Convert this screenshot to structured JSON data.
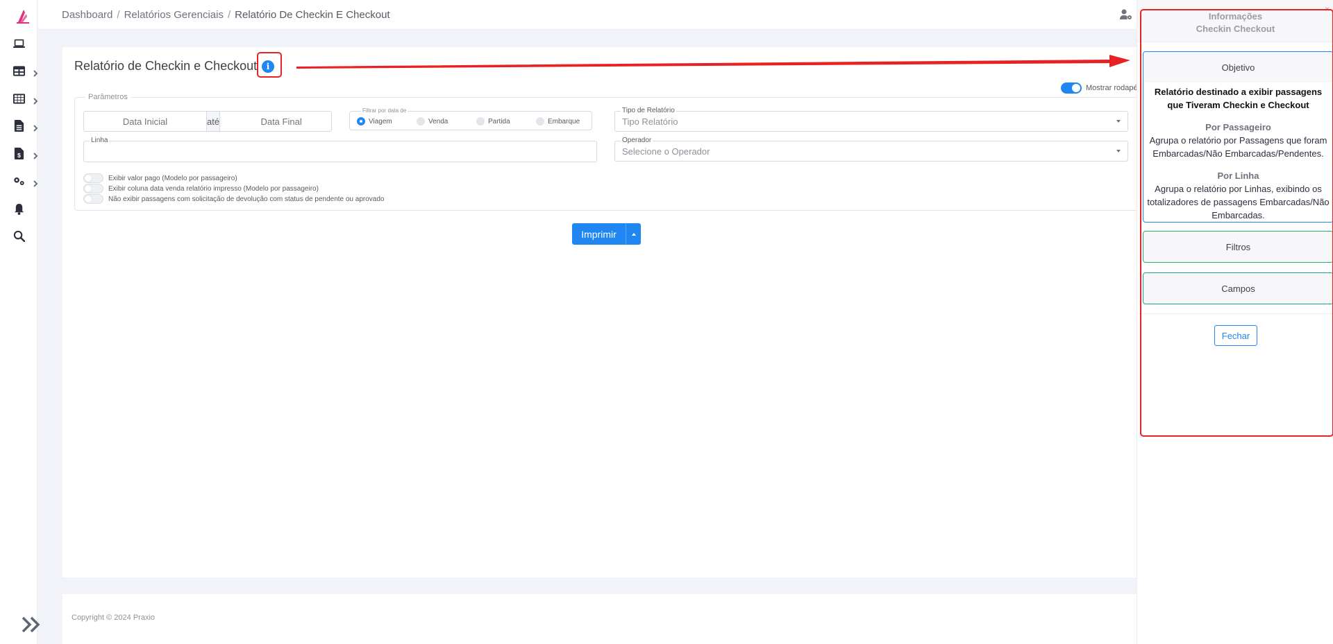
{
  "breadcrumb": {
    "items": [
      "Dashboard",
      "Relatórios Gerenciais"
    ],
    "separator": "/",
    "current": "Relatório De Checkin E Checkout"
  },
  "page": {
    "title": "Relatório de Checkin e Checkout",
    "info_icon": "info-icon",
    "footer_toggle_label": "Mostrar rodapé",
    "footer_toggle_on": true
  },
  "params": {
    "legend": "Parâmetros",
    "date_start_placeholder": "Data Inicial",
    "date_separator": "até",
    "date_end_placeholder": "Data Final",
    "filter_legend": "Filtrar por data de",
    "filter_options": [
      "Viagem",
      "Venda",
      "Partida",
      "Embarque"
    ],
    "filter_selected": "Viagem",
    "report_type_label": "Tipo de Relatório",
    "report_type_value": "Tipo Relatório",
    "line_label": "Linha",
    "line_value": "",
    "operator_label": "Operador",
    "operator_value": "Selecione o Operador",
    "switches": [
      "Exibir valor pago (Modelo por passageiro)",
      "Exibir coluna data venda relatório impresso (Modelo por passageiro)",
      "Não exibir passagens com solicitação de devolução com status de pendente ou aprovado"
    ]
  },
  "actions": {
    "print_label": "Imprimir"
  },
  "footer": {
    "copyright": "Copyright © 2024 Praxio"
  },
  "info_panel": {
    "title_line1": "Informações",
    "title_line2": "Checkin Checkout",
    "close_x": "×",
    "objective_title": "Objetivo",
    "objective_intro": "Relatório destinado a exibir passagens que Tiveram Checkin e Checkout",
    "por_passageiro_title": "Por Passageiro",
    "por_passageiro_text": "Agrupa o relatório por Passagens que foram Embarcadas/Não Embarcadas/Pendentes.",
    "por_linha_title": "Por Linha",
    "por_linha_text": "Agrupa o relatório por Linhas, exibindo os totalizadores de passagens Embarcadas/Não Embarcadas.",
    "filters_title": "Filtros",
    "fields_title": "Campos",
    "close_label": "Fechar"
  },
  "colors": {
    "accent": "#1f86f2",
    "annotation_red": "#e82222"
  },
  "sidebar_icons": [
    "laptop-icon",
    "table-icon",
    "grid-icon",
    "file-icon",
    "invoice-icon",
    "cogs-icon",
    "bell-icon",
    "search-icon"
  ]
}
